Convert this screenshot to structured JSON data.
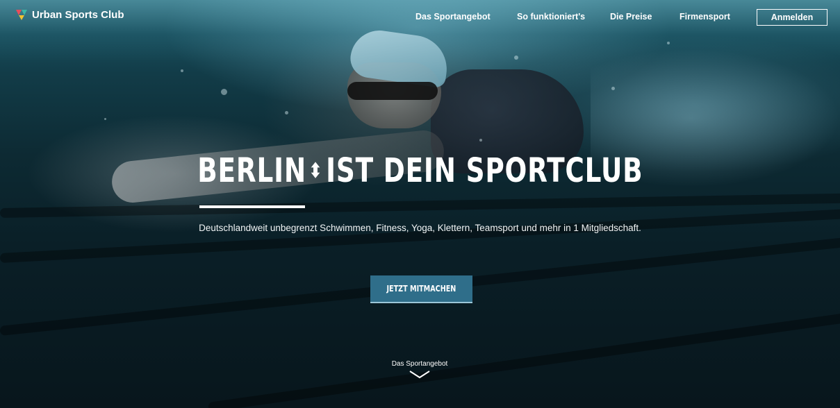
{
  "brand": {
    "name": "Urban Sports Club",
    "logo_colors": [
      "#e84d5b",
      "#3bb7a8",
      "#f2c230"
    ]
  },
  "nav": {
    "items": [
      {
        "label": "Das Sportangebot"
      },
      {
        "label": "So funktioniert's"
      },
      {
        "label": "Die Preise"
      },
      {
        "label": "Firmensport"
      }
    ],
    "login_label": "Anmelden"
  },
  "hero": {
    "headline_city": "BERLIN",
    "headline_separator": "⬍",
    "headline_rest": "IST DEIN SPORTCLUB",
    "subline": "Deutschlandweit unbegrenzt Schwimmen, Fitness, Yoga, Klettern, Teamsport und mehr in 1 Mitgliedschaft.",
    "cta_label": "JETZT MITMACHEN",
    "scroll_label": "Das Sportangebot",
    "scroll_icon": "chevron-down-icon",
    "cta_color": "#2f6e8a"
  }
}
